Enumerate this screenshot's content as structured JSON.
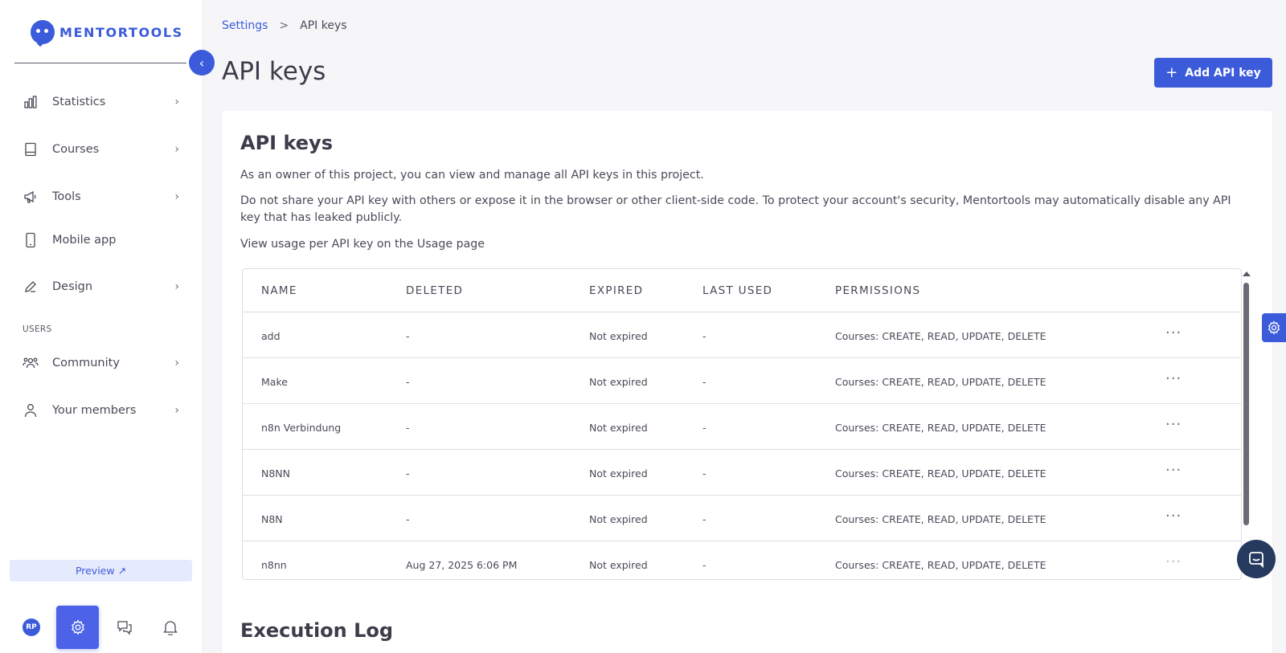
{
  "brand": {
    "name": "MENTORTOOLS",
    "accent": "#3b5bdb"
  },
  "sidebar": {
    "items": [
      {
        "label": "Statistics",
        "icon": "bar-chart-icon",
        "has_submenu": true
      },
      {
        "label": "Courses",
        "icon": "book-icon",
        "has_submenu": true
      },
      {
        "label": "Tools",
        "icon": "megaphone-icon",
        "has_submenu": true
      },
      {
        "label": "Mobile app",
        "icon": "phone-icon",
        "has_submenu": false
      },
      {
        "label": "Design",
        "icon": "pencil-icon",
        "has_submenu": true
      }
    ],
    "users_section": "USERS",
    "user_items": [
      {
        "label": "Community",
        "icon": "people-icon",
        "has_submenu": true
      },
      {
        "label": "Your members",
        "icon": "user-icon",
        "has_submenu": true
      }
    ],
    "preview_label": "Preview ↗",
    "avatar_initials": "RP"
  },
  "breadcrumb": {
    "parent": "Settings",
    "separator": ">",
    "current": "API keys"
  },
  "page": {
    "title": "API keys",
    "add_button_label": "Add API key"
  },
  "card": {
    "title": "API keys",
    "paragraphs": [
      "As an owner of this project, you can view and manage all API keys in this project.",
      "Do not share your API key with others or expose it in the browser or other client-side code. To protect your account's security, Mentortools may automatically disable any API key that has leaked publicly.",
      "View usage per API key on the Usage page"
    ]
  },
  "table": {
    "columns": [
      "NAME",
      "DELETED",
      "EXPIRED",
      "LAST USED",
      "PERMISSIONS"
    ],
    "rows": [
      {
        "name": "add",
        "deleted": "-",
        "expired": "Not expired",
        "last_used": "-",
        "permissions": "Courses: CREATE, READ, UPDATE, DELETE"
      },
      {
        "name": "Make",
        "deleted": "-",
        "expired": "Not expired",
        "last_used": "-",
        "permissions": "Courses: CREATE, READ, UPDATE, DELETE"
      },
      {
        "name": "n8n Verbindung",
        "deleted": "-",
        "expired": "Not expired",
        "last_used": "-",
        "permissions": "Courses: CREATE, READ, UPDATE, DELETE"
      },
      {
        "name": "N8NN",
        "deleted": "-",
        "expired": "Not expired",
        "last_used": "-",
        "permissions": "Courses: CREATE, READ, UPDATE, DELETE"
      },
      {
        "name": "N8N",
        "deleted": "-",
        "expired": "Not expired",
        "last_used": "-",
        "permissions": "Courses: CREATE, READ, UPDATE, DELETE"
      },
      {
        "name": "n8nn",
        "deleted": "Aug 27, 2025 6:06 PM",
        "expired": "Not expired",
        "last_used": "-",
        "permissions": "Courses: CREATE, READ, UPDATE, DELETE"
      }
    ],
    "row_menu": "···"
  },
  "execution_log": {
    "title": "Execution Log"
  }
}
